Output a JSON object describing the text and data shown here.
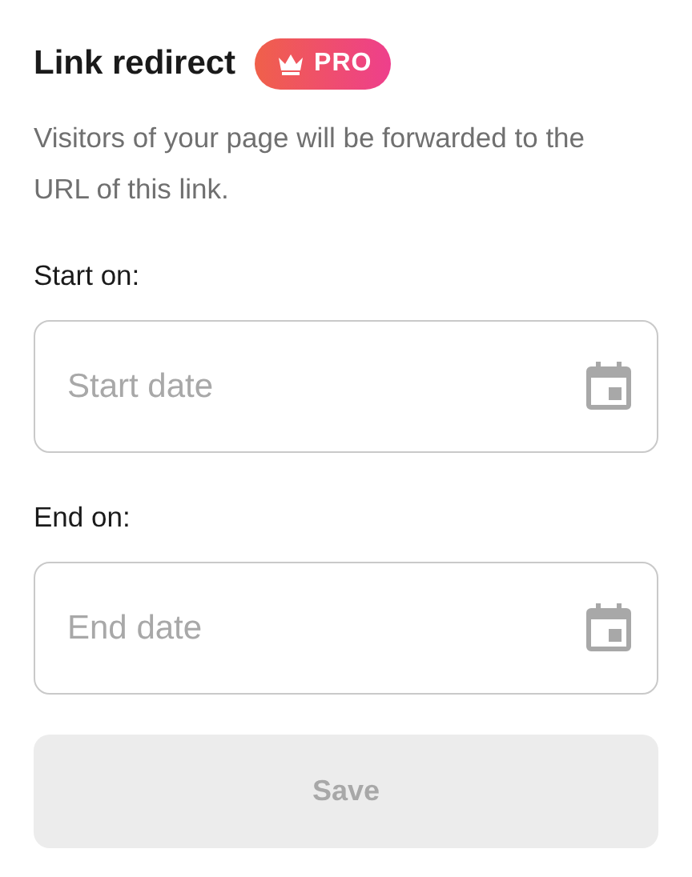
{
  "header": {
    "title": "Link redirect",
    "badge": {
      "label": "PRO"
    }
  },
  "description": "Visitors of your page will be forwarded to the URL of this link.",
  "fields": [
    {
      "label": "Start on:",
      "placeholder": "Start date"
    },
    {
      "label": "End on:",
      "placeholder": "End date"
    }
  ],
  "save_button": {
    "label": "Save",
    "disabled": true
  }
}
